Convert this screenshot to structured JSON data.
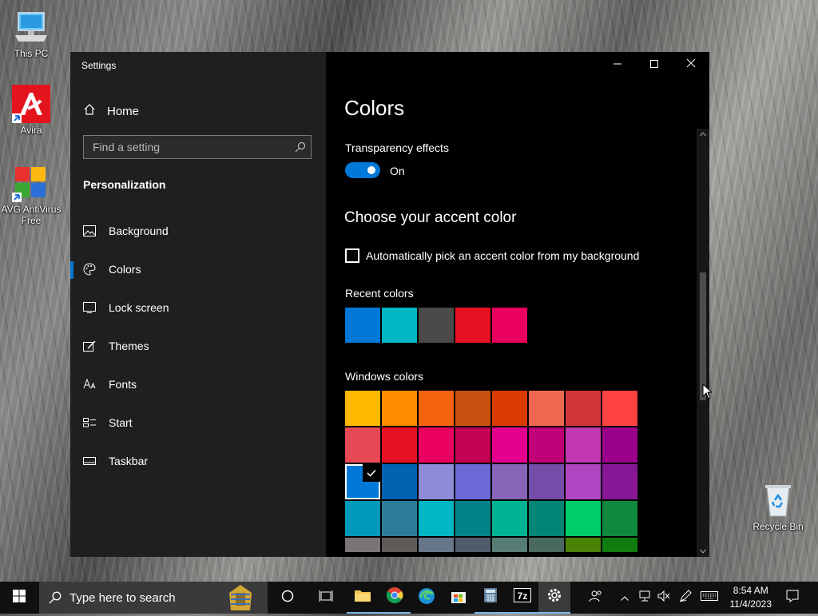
{
  "desktop": {
    "icons": [
      {
        "label": "This PC"
      },
      {
        "label": "Avira"
      },
      {
        "label": "AVG AntiVirus Free"
      },
      {
        "label": "Recycle Bin"
      }
    ]
  },
  "window": {
    "title": "Settings",
    "sidebar": {
      "home_label": "Home",
      "search_placeholder": "Find a setting",
      "section_heading": "Personalization",
      "items": [
        {
          "label": "Background",
          "icon": "picture-icon"
        },
        {
          "label": "Colors",
          "icon": "palette-icon",
          "active": true
        },
        {
          "label": "Lock screen",
          "icon": "lock-screen-icon"
        },
        {
          "label": "Themes",
          "icon": "themes-icon"
        },
        {
          "label": "Fonts",
          "icon": "fonts-icon"
        },
        {
          "label": "Start",
          "icon": "start-icon"
        },
        {
          "label": "Taskbar",
          "icon": "taskbar-icon"
        }
      ]
    },
    "content": {
      "title": "Colors",
      "transparency_label": "Transparency effects",
      "transparency_state": "On",
      "accent_heading": "Choose your accent color",
      "auto_pick_label": "Automatically pick an accent color from my background",
      "recent_label": "Recent colors",
      "recent_colors": [
        "#0078d7",
        "#00b7c3",
        "#4c4a48",
        "#e81123",
        "#ea005e"
      ],
      "windows_label": "Windows colors",
      "windows_colors": [
        [
          "#ffb900",
          "#ff8c00",
          "#f7630c",
          "#ca5010",
          "#da3b01",
          "#ef6950",
          "#d13438",
          "#ff4343"
        ],
        [
          "#e74856",
          "#e81123",
          "#ea005e",
          "#c30052",
          "#e3008c",
          "#bf0077",
          "#c239b3",
          "#9a0089"
        ],
        [
          "#0078d7",
          "#0063b1",
          "#8e8cd8",
          "#6b69d6",
          "#8764b8",
          "#744da9",
          "#b146c2",
          "#881798"
        ],
        [
          "#0099bc",
          "#2d7d9a",
          "#00b7c3",
          "#038387",
          "#00b294",
          "#018574",
          "#00cc6a",
          "#10893e"
        ],
        [
          "#7a7574",
          "#5d5a58",
          "#68768a",
          "#515c6b",
          "#567c73",
          "#486860",
          "#498205",
          "#107c10"
        ]
      ],
      "selected_color": "#0078d7"
    }
  },
  "taskbar": {
    "search_placeholder": "Type here to search",
    "time": "8:54 AM",
    "date": "11/4/2023"
  },
  "colors": {
    "accent": "#0078d7",
    "sidebar_bg": "#1f1f1f",
    "content_bg": "#000000"
  }
}
